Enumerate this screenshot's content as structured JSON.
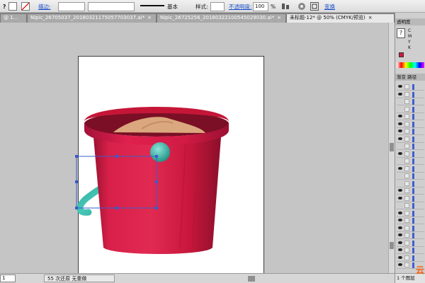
{
  "control_bar": {
    "question_glyph": "?",
    "stroke_label": "描边:",
    "style_label": "基本",
    "style2_label": "样式:",
    "opacity_label": "不透明度:",
    "opacity_value": "100",
    "percent": "%",
    "transform_label": "变换"
  },
  "tabs": [
    {
      "label": "@ 1...",
      "active": false
    },
    {
      "label": "Nipic_26705037_20180321175057703037.ai*",
      "active": false
    },
    {
      "label": "Nipic_26725256_20180322100545029030.ai*",
      "active": false
    },
    {
      "label": "未标题-12* @ 50% (CMYK/预览)",
      "active": true
    }
  ],
  "tab_close": "×",
  "statusbar": {
    "zoom": "1",
    "status_text": "55 次还原",
    "status_text2": "无重做"
  },
  "panels": {
    "transparency_title": "透明度",
    "color_title": "",
    "layers_title": "渐变",
    "layers_title2": "路径",
    "layers_footer": "1 个图层",
    "cmyk_labels": [
      "C",
      "M",
      "Y",
      "K"
    ]
  },
  "artwork": {
    "bucket_color": "#d2183e",
    "rim_color": "#c51638",
    "handle_color": "#2aa79a",
    "sand_color": "#dba77e"
  },
  "logo_glyph": "云"
}
